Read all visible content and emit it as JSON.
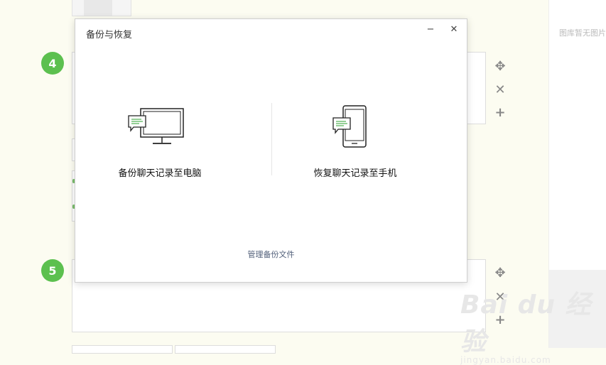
{
  "background": {
    "steps": [
      "4",
      "5"
    ],
    "right_panel_empty_text": "图库暂无图片"
  },
  "watermark": {
    "logo_text": "Bai du 经验",
    "url_text": "jingyan.baidu.com"
  },
  "dialog": {
    "title": "备份与恢复",
    "minimize_glyph": "−",
    "close_glyph": "✕",
    "backup_label": "备份聊天记录至电脑",
    "restore_label": "恢复聊天记录至手机",
    "manage_label": "管理备份文件"
  },
  "colors": {
    "accent_green": "#5cc04f",
    "link": "#52607a",
    "chat_bubble_line": "#4caf50"
  }
}
